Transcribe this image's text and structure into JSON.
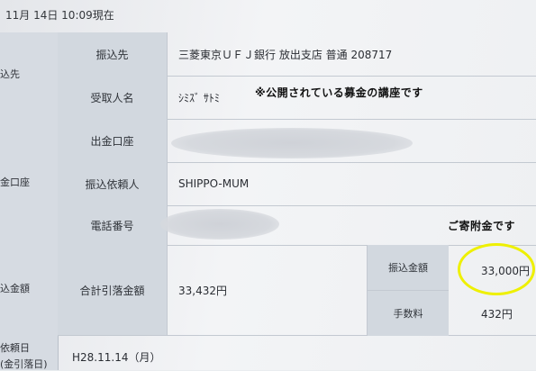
{
  "timestamp": "11月 14日 10:09現在",
  "left_column": {
    "section1": "込先",
    "section2": "金口座",
    "section3": "込金額",
    "section4_line1": "依頼日",
    "section4_line2": "(金引落日)"
  },
  "rows": {
    "payee": {
      "label": "振込先",
      "value": "三菱東京ＵＦＪ銀行 放出支店 普通 208717"
    },
    "recipient": {
      "label": "受取人名",
      "value": "ｼﾐｽﾞ ｻﾄﾐ"
    },
    "source_account": {
      "label": "出金口座",
      "value": ""
    },
    "requester": {
      "label": "振込依頼人",
      "value": "SHIPPO-MUM"
    },
    "phone": {
      "label": "電話番号",
      "value": ""
    }
  },
  "annotations": {
    "public_account_note": "※公開されている募金の講座です",
    "donation_note": "ご寄附金です"
  },
  "amounts": {
    "total_label": "合計引落金額",
    "total_value": "33,432円",
    "transfer_label": "振込金額",
    "transfer_value": "33,000円",
    "fee_label": "手数料",
    "fee_value": "432円"
  },
  "date_row": {
    "value": "H28.11.14（月）"
  },
  "colors": {
    "highlight_ring": "#eef000",
    "label_cell": "#d2d8df"
  }
}
